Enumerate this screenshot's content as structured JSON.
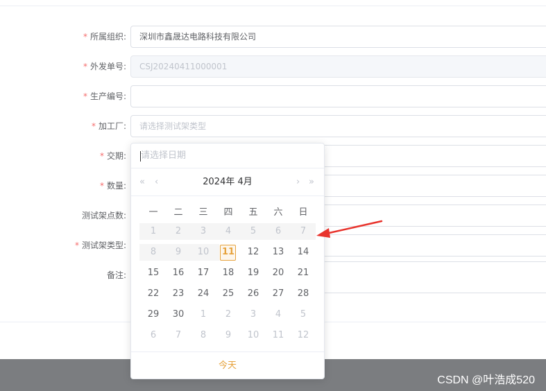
{
  "form": {
    "org_label": "所属组织:",
    "org_value": "深圳市鑫晟达电路科技有限公司",
    "order_label": "外发单号:",
    "order_value": "CSJ20240411000001",
    "prod_label": "生产编号:",
    "factory_label": "加工厂:",
    "factory_placeholder": "请选择测试架类型",
    "delivery_label": "交期:",
    "qty_label": "数量:",
    "points_label": "测试架点数:",
    "type_label": "测试架类型:",
    "remark_label": "备注:",
    "required_mark": "*"
  },
  "datepicker": {
    "placeholder": "请选择日期",
    "title": "2024年 4月",
    "prev_year": "«",
    "prev_month": "‹",
    "next_month": "›",
    "next_year": "»",
    "weekdays": [
      "一",
      "二",
      "三",
      "四",
      "五",
      "六",
      "日"
    ],
    "weeks": [
      [
        "1",
        "2",
        "3",
        "4",
        "5",
        "6",
        "7"
      ],
      [
        "8",
        "9",
        "10",
        "11",
        "12",
        "13",
        "14"
      ],
      [
        "15",
        "16",
        "17",
        "18",
        "19",
        "20",
        "21"
      ],
      [
        "22",
        "23",
        "24",
        "25",
        "26",
        "27",
        "28"
      ],
      [
        "29",
        "30",
        "1",
        "2",
        "3",
        "4",
        "5"
      ],
      [
        "6",
        "7",
        "8",
        "9",
        "10",
        "11",
        "12"
      ]
    ],
    "today_button": "今天",
    "selected_day": "11"
  },
  "watermark": "CSDN @叶浩成520",
  "colors": {
    "required": "#f56c6c",
    "today": "#e6a23c",
    "arrow": "#e8332c"
  }
}
